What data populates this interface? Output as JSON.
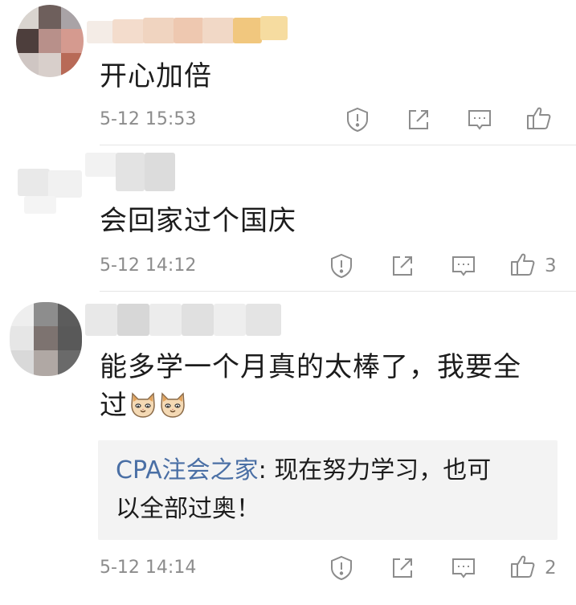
{
  "comments": [
    {
      "text": "开心加倍",
      "date": "5-12 15:53",
      "likes": ""
    },
    {
      "text": "会回家过个国庆",
      "date": "5-12 14:12",
      "likes": "3"
    },
    {
      "text_line1": "能多学一个月真的太棒了，我要全",
      "text_line2": "过",
      "date": "5-12 14:14",
      "likes": "2",
      "reply": {
        "author": "CPA注会之家",
        "separator": ": ",
        "line1": "现在努力学习，也可",
        "line2": "以全部过奥！"
      }
    }
  ],
  "icons": {
    "report": "report-icon",
    "share": "share-icon",
    "reply": "reply-icon",
    "like": "thumbs-up-icon",
    "emoji": "cat-emoji-icon"
  },
  "colors": {
    "author_link": "#4a6fa5",
    "meta_text": "#8c8c8c",
    "reply_bg": "#f3f3f3"
  }
}
